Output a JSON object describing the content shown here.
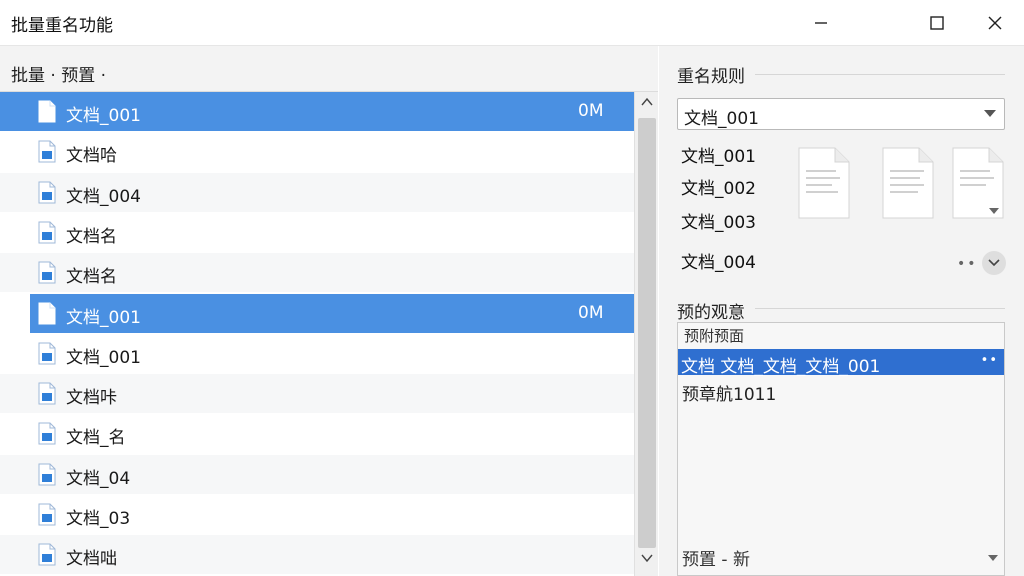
{
  "window": {
    "title": "批量重名功能",
    "controls": {
      "minimize": "minimize-icon",
      "maximize": "maximize-icon",
      "close": "close-icon"
    }
  },
  "left_panel": {
    "header": "批量 · 预置 ·",
    "rows": [
      {
        "name": "文档_001",
        "size": "0M",
        "selected": true,
        "alt": false
      },
      {
        "name": "文档哈",
        "size": "",
        "selected": false,
        "alt": false
      },
      {
        "name": "文档_004",
        "size": "",
        "selected": false,
        "alt": true
      },
      {
        "name": "文档名",
        "size": "",
        "selected": false,
        "alt": false
      },
      {
        "name": "文档名",
        "size": "",
        "selected": false,
        "alt": true
      },
      {
        "name": "文档_001",
        "size": "0M",
        "selected": true,
        "alt": false
      },
      {
        "name": "文档_001",
        "size": "",
        "selected": false,
        "alt": false
      },
      {
        "name": "文档咔",
        "size": "",
        "selected": false,
        "alt": true
      },
      {
        "name": "文档_名",
        "size": "",
        "selected": false,
        "alt": false
      },
      {
        "name": "文档_04",
        "size": "",
        "selected": false,
        "alt": true
      },
      {
        "name": "文档_03",
        "size": "",
        "selected": false,
        "alt": false
      },
      {
        "name": "文档咄",
        "size": "",
        "selected": false,
        "alt": true
      }
    ]
  },
  "right_panel": {
    "rule_title": "重名规则",
    "rule_combo_value": "文档_001",
    "samples": [
      "文档_001",
      "文档_002",
      "文档_003",
      "文档_004"
    ],
    "more_label": "••",
    "preview_title": "预的观意",
    "preview_box_label": "预附预面",
    "preview_selected": "文档 文档_文档_文档_001",
    "preview_selected_dots": "••",
    "preview_line": "预章航1011",
    "preview_bottom": "预置 - 新"
  },
  "colors": {
    "selection": "#4a90e2",
    "preview_selection": "#2f6fd0",
    "panel_bg": "#f3f3f3"
  }
}
